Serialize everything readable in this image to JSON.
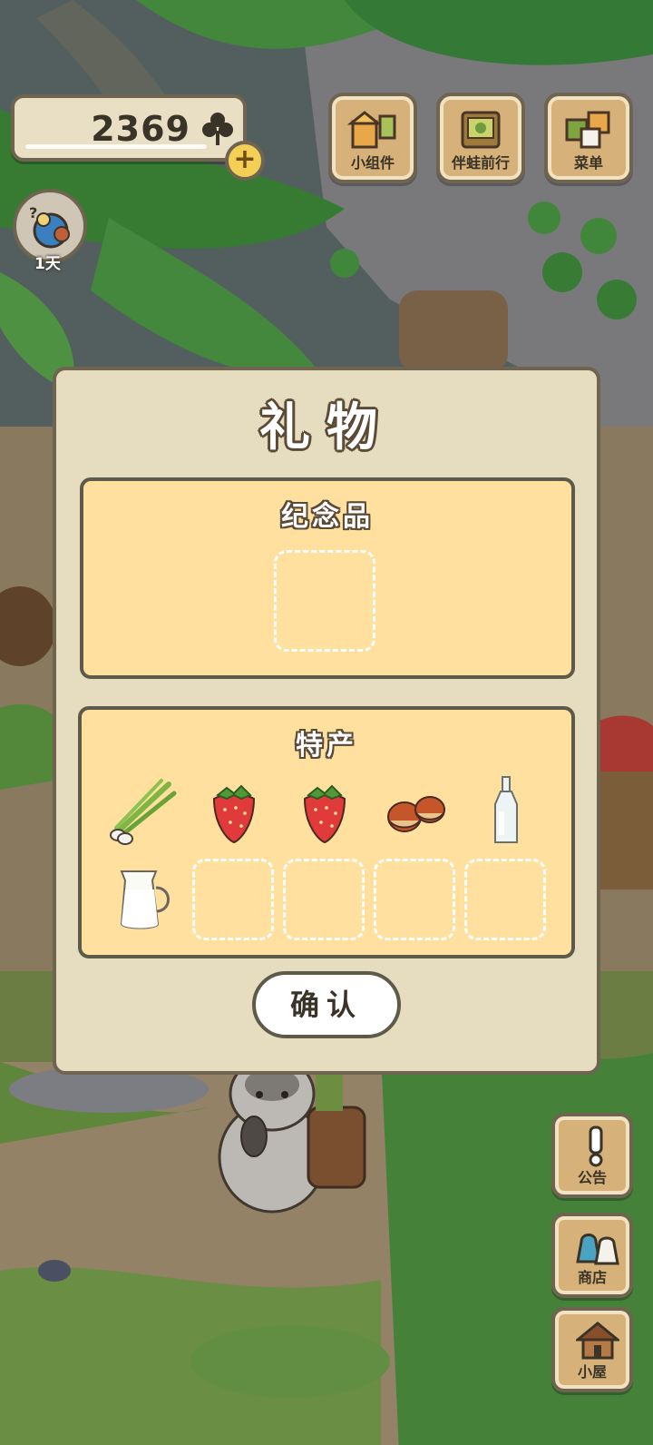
{
  "header": {
    "clover_count": "2369",
    "add_label": "+",
    "days_label": "1天"
  },
  "top_menu": {
    "widgets_label": "小组件",
    "companion_label": "伴蛙前行",
    "menu_label": "菜单"
  },
  "dialog": {
    "title": "礼物",
    "souvenir": {
      "title": "纪念品",
      "slots": [
        "empty"
      ]
    },
    "specialty": {
      "title": "特产",
      "items": [
        "green-onion",
        "strawberry",
        "strawberry",
        "chestnuts",
        "glass-bottle",
        "milk-jug"
      ],
      "empty_slots": 4
    },
    "confirm_label": "确认"
  },
  "side_menu": {
    "notice_label": "公告",
    "shop_label": "商店",
    "house_label": "小屋"
  },
  "colors": {
    "panel": "#ffe09e",
    "dialog": "#e6ddc0",
    "outline": "#5e5a4a",
    "button_wood": "#d6b27a"
  }
}
